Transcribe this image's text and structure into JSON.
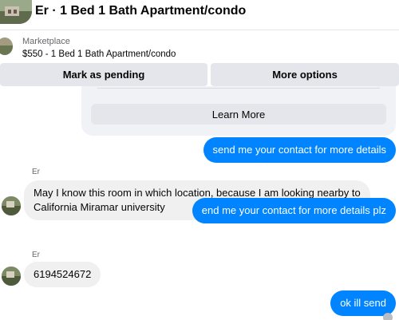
{
  "header": {
    "title": "Er · 1 Bed 1 Bath Apartment/condo"
  },
  "listing": {
    "source": "Marketplace",
    "title": "$550 - 1 Bed 1 Bath Apartment/condo"
  },
  "actions": {
    "mark_pending": "Mark as pending",
    "more_options": "More options"
  },
  "card": {
    "learn_more": "Learn More"
  },
  "messages": [
    {
      "direction": "outgoing",
      "text": "send me your contact for more details"
    },
    {
      "direction": "incoming",
      "sender": "Er",
      "lines": [
        "May I know this room in which location, because I am looking nearby to",
        "California Miramar university"
      ]
    },
    {
      "direction": "outgoing",
      "text": "end me your contact for more details plz"
    },
    {
      "direction": "incoming",
      "sender": "Er",
      "text": "6194524672"
    },
    {
      "direction": "outgoing",
      "text": "ok ill send"
    }
  ],
  "colors": {
    "outgoing_bubble": "#0084ff",
    "incoming_bubble": "#f0f0f0",
    "button_bg": "#e4e6eb"
  }
}
